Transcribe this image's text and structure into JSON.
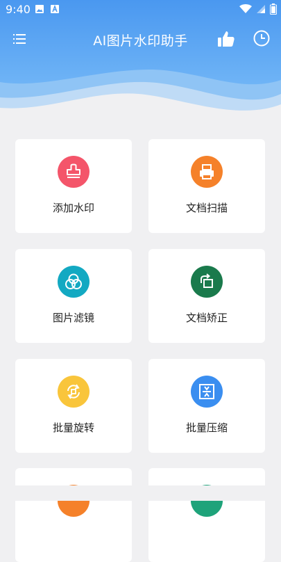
{
  "status_bar": {
    "time": "9:40",
    "icons": [
      "image-icon",
      "a-icon",
      "wifi-icon",
      "signal-icon",
      "battery-icon"
    ]
  },
  "app_bar": {
    "title": "AI图片水印助手",
    "icons": [
      "menu-icon",
      "thumbs-up-icon",
      "clock-icon"
    ]
  },
  "colors": {
    "header_blue": "#4a9df0",
    "background": "#f0f0f2",
    "card": "#ffffff"
  },
  "tools": [
    {
      "label": "添加水印",
      "icon": "stamp-icon",
      "color": "#f4556a"
    },
    {
      "label": "文档扫描",
      "icon": "printer-icon",
      "color": "#f5812a"
    },
    {
      "label": "图片滤镜",
      "icon": "filter-circles-icon",
      "color": "#13a9c2"
    },
    {
      "label": "文档矫正",
      "icon": "rotate-square-icon",
      "color": "#1a7a4c"
    },
    {
      "label": "批量旋转",
      "icon": "rotate-arrows-icon",
      "color": "#f9c53b"
    },
    {
      "label": "批量压缩",
      "icon": "compress-icon",
      "color": "#3a8ef0"
    },
    {
      "label": "",
      "icon": "partial-icon",
      "color": "#f5812a"
    },
    {
      "label": "",
      "icon": "partial-icon",
      "color": "#1ea37a"
    }
  ]
}
